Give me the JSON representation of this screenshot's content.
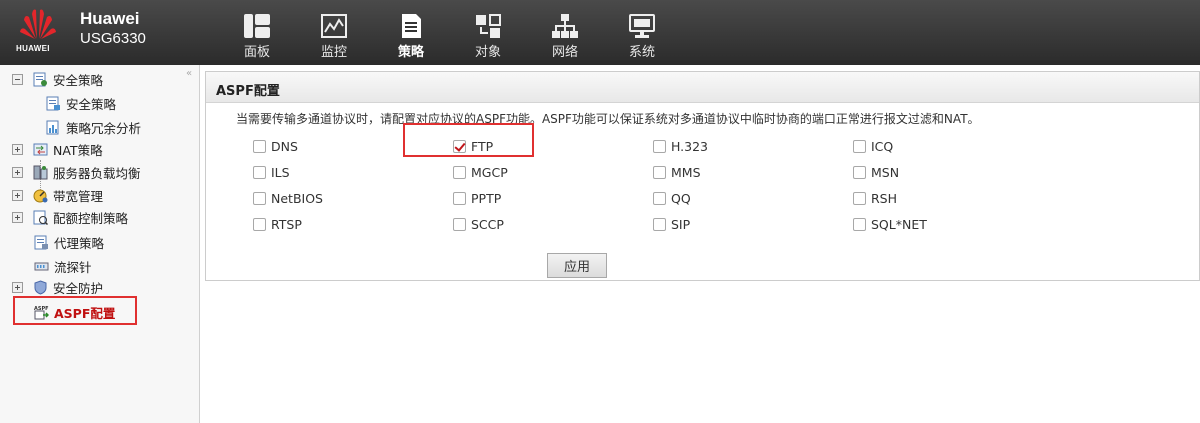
{
  "header": {
    "logo_text": "HUAWEI",
    "product_name": "Huawei",
    "product_model": "USG6330",
    "nav": [
      {
        "label": "面板",
        "icon": "dashboard-icon"
      },
      {
        "label": "监控",
        "icon": "monitor-chart-icon"
      },
      {
        "label": "策略",
        "icon": "policy-document-icon",
        "active": true
      },
      {
        "label": "对象",
        "icon": "objects-icon"
      },
      {
        "label": "网络",
        "icon": "network-icon"
      },
      {
        "label": "系统",
        "icon": "system-computer-icon"
      }
    ]
  },
  "sidebar": {
    "items": [
      {
        "label": "安全策略",
        "expander": "minus",
        "icon": "security-policy-icon"
      },
      {
        "label": "安全策略",
        "icon": "policy-icon"
      },
      {
        "label": "策略冗余分析",
        "icon": "policy-analysis-icon"
      },
      {
        "label": "NAT策略",
        "expander": "plus",
        "icon": "nat-icon"
      },
      {
        "label": "服务器负载均衡",
        "expander": "plus",
        "icon": "load-balance-icon"
      },
      {
        "label": "带宽管理",
        "expander": "plus",
        "icon": "bandwidth-icon"
      },
      {
        "label": "配额控制策略",
        "expander": "plus",
        "icon": "quota-icon"
      },
      {
        "label": "代理策略",
        "icon": "proxy-icon"
      },
      {
        "label": "流探针",
        "icon": "flow-probe-icon"
      },
      {
        "label": "安全防护",
        "expander": "plus",
        "icon": "shield-icon"
      },
      {
        "label": "ASPF配置",
        "icon": "aspf-icon",
        "selected": true
      }
    ]
  },
  "main": {
    "title": "ASPF配置",
    "description": "当需要传输多通道协议时，请配置对应协议的ASPF功能。ASPF功能可以保证系统对多通道协议中临时协商的端口正常进行报文过滤和NAT。",
    "protocols": [
      {
        "label": "DNS",
        "checked": false
      },
      {
        "label": "FTP",
        "checked": true
      },
      {
        "label": "H.323",
        "checked": false
      },
      {
        "label": "ICQ",
        "checked": false
      },
      {
        "label": "ILS",
        "checked": false
      },
      {
        "label": "MGCP",
        "checked": false
      },
      {
        "label": "MMS",
        "checked": false
      },
      {
        "label": "MSN",
        "checked": false
      },
      {
        "label": "NetBIOS",
        "checked": false
      },
      {
        "label": "PPTP",
        "checked": false
      },
      {
        "label": "QQ",
        "checked": false
      },
      {
        "label": "RSH",
        "checked": false
      },
      {
        "label": "RTSP",
        "checked": false
      },
      {
        "label": "SCCP",
        "checked": false
      },
      {
        "label": "SIP",
        "checked": false
      },
      {
        "label": "SQL*NET",
        "checked": false
      }
    ],
    "apply_label": "应用"
  }
}
